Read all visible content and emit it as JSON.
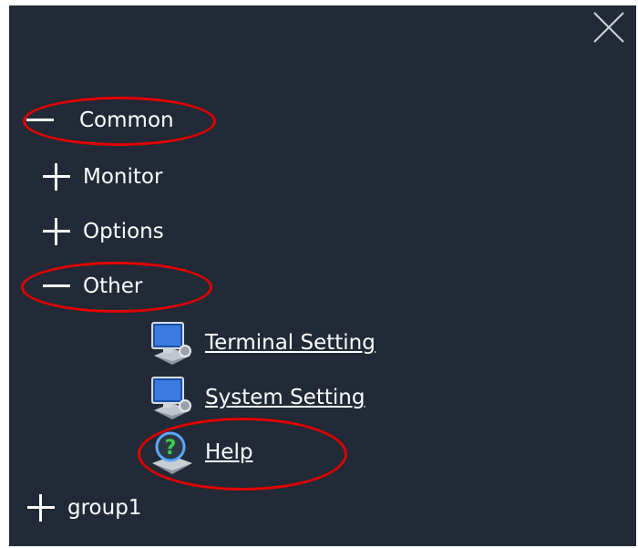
{
  "colors": {
    "panel_bg": "#212a36",
    "text": "#ffffff",
    "annotation": "#e00000"
  },
  "icons": {
    "close": "close-icon",
    "collapse": "minus-icon",
    "expand": "plus-icon",
    "monitor": "monitor-settings-icon",
    "help": "help-icon"
  },
  "tree": {
    "common": {
      "label": "Common",
      "state": "expanded"
    },
    "monitor": {
      "label": "Monitor",
      "state": "collapsed"
    },
    "options": {
      "label": "Options",
      "state": "collapsed"
    },
    "other": {
      "label": "Other",
      "state": "expanded"
    },
    "other_items": [
      {
        "label": "Terminal Setting",
        "icon": "monitor-settings-icon"
      },
      {
        "label": "System Setting",
        "icon": "monitor-settings-icon"
      },
      {
        "label": "Help",
        "icon": "help-icon"
      }
    ],
    "group1": {
      "label": "group1",
      "state": "collapsed"
    }
  },
  "annotations": [
    "Common",
    "Other",
    "Help"
  ]
}
